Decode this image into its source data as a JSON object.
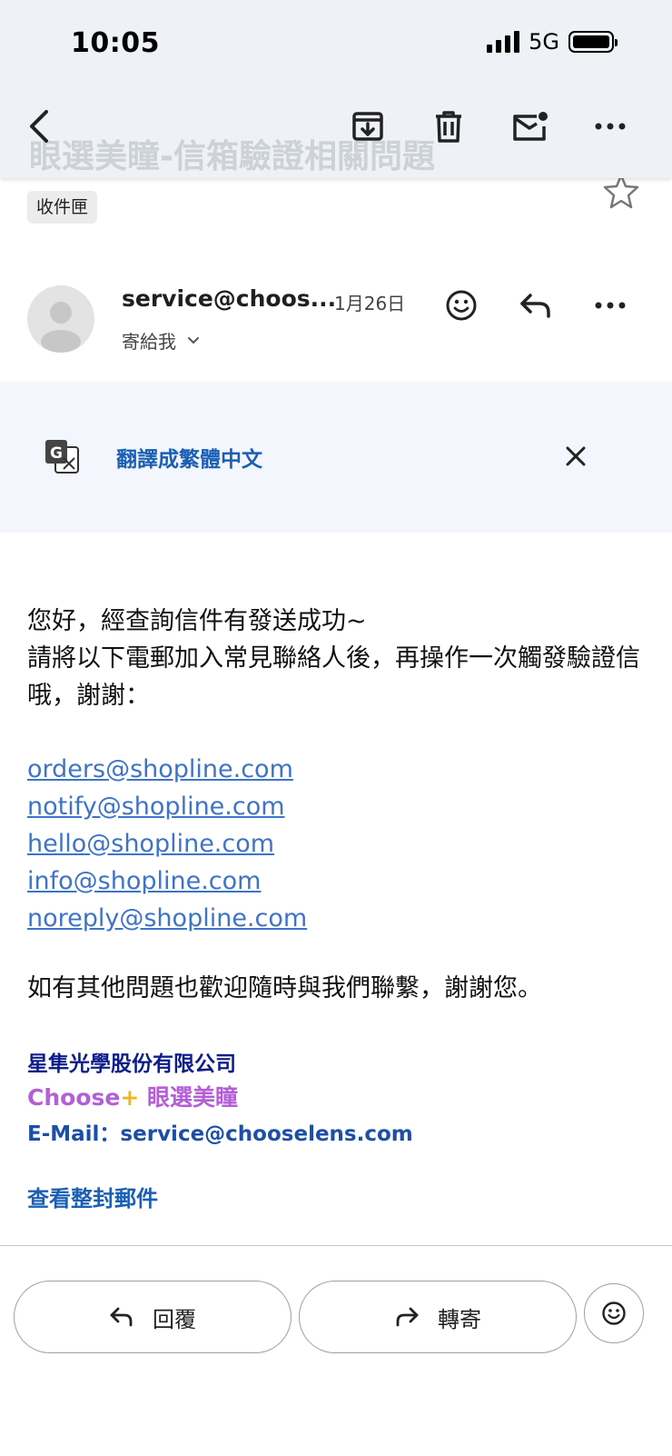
{
  "status_bar": {
    "time": "10:05",
    "network": "5G"
  },
  "toolbar": {
    "subject_ghost": "眼選美瞳-信箱驗證相關問題"
  },
  "label": "收件匣",
  "message": {
    "sender": "service@choos...",
    "date": "1月26日",
    "recipient": "寄給我"
  },
  "translate": {
    "label": "翻譯成繁體中文"
  },
  "body": {
    "line1": "您好，經查詢信件有發送成功~",
    "line2": "請將以下電郵加入常見聯絡人後，再操作一次觸發驗證信哦，謝謝：",
    "emails": [
      "orders@shopline.com",
      "notify@shopline.com",
      "hello@shopline.com",
      "info@shopline.com",
      "noreply@shopline.com"
    ],
    "closing": "如有其他問題也歡迎隨時與我們聯繫，謝謝您。"
  },
  "signature": {
    "company": "星隼光學股份有限公司",
    "brand_prefix": "Choose",
    "brand_plus": "+",
    "brand_name": " 眼選美瞳",
    "email_line": "E-Mail：service@chooselens.com"
  },
  "view_full": "查看整封郵件",
  "actions": {
    "reply": "回覆",
    "forward": "轉寄"
  }
}
